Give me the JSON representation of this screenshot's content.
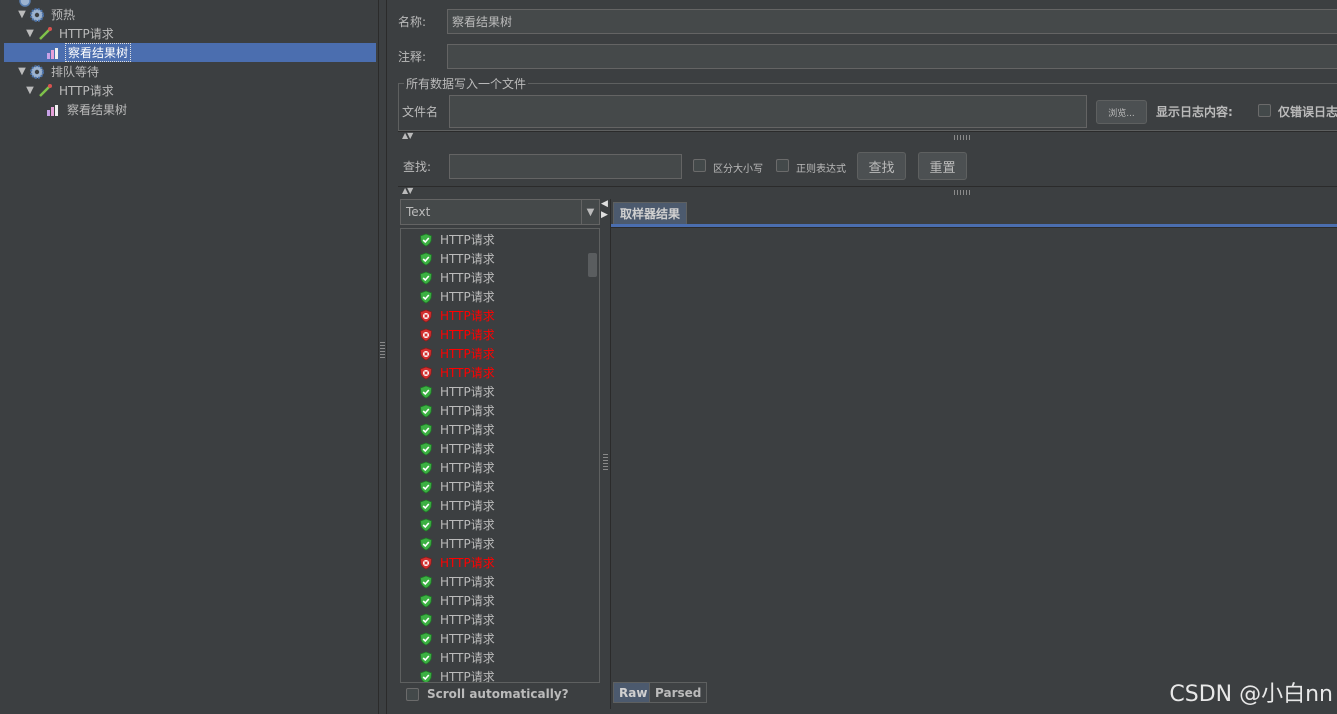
{
  "tree": {
    "items": [
      {
        "label": "预热",
        "type": "thread-group",
        "icon": "gear-icon"
      },
      {
        "label": "HTTP请求",
        "type": "sampler",
        "icon": "pipette-icon"
      },
      {
        "label": "察看结果树",
        "type": "listener",
        "icon": "chart-icon",
        "selected": true
      },
      {
        "label": "排队等待",
        "type": "thread-group",
        "icon": "gear-icon"
      },
      {
        "label": "HTTP请求",
        "type": "sampler",
        "icon": "pipette-icon"
      },
      {
        "label": "察看结果树",
        "type": "listener",
        "icon": "chart-icon"
      }
    ]
  },
  "form": {
    "name_label": "名称:",
    "name_value": "察看结果树",
    "comment_label": "注释:",
    "comment_value": "",
    "file_group_title": "所有数据写入一个文件",
    "file_label": "文件名",
    "file_value": "",
    "browse_label": "浏览...",
    "log_content_label": "显示日志内容:",
    "errors_only_label": "仅错误日志"
  },
  "search": {
    "label": "查找:",
    "value": "",
    "case_label": "区分大小写",
    "regex_label": "正则表达式",
    "find_button": "查找",
    "reset_button": "重置"
  },
  "results": {
    "renderer": "Text",
    "samples": [
      {
        "label": "HTTP请求",
        "status": "ok"
      },
      {
        "label": "HTTP请求",
        "status": "ok"
      },
      {
        "label": "HTTP请求",
        "status": "ok"
      },
      {
        "label": "HTTP请求",
        "status": "ok"
      },
      {
        "label": "HTTP请求",
        "status": "error"
      },
      {
        "label": "HTTP请求",
        "status": "error"
      },
      {
        "label": "HTTP请求",
        "status": "error"
      },
      {
        "label": "HTTP请求",
        "status": "error"
      },
      {
        "label": "HTTP请求",
        "status": "ok"
      },
      {
        "label": "HTTP请求",
        "status": "ok"
      },
      {
        "label": "HTTP请求",
        "status": "ok"
      },
      {
        "label": "HTTP请求",
        "status": "ok"
      },
      {
        "label": "HTTP请求",
        "status": "ok"
      },
      {
        "label": "HTTP请求",
        "status": "ok"
      },
      {
        "label": "HTTP请求",
        "status": "ok"
      },
      {
        "label": "HTTP请求",
        "status": "ok"
      },
      {
        "label": "HTTP请求",
        "status": "ok"
      },
      {
        "label": "HTTP请求",
        "status": "error"
      },
      {
        "label": "HTTP请求",
        "status": "ok"
      },
      {
        "label": "HTTP请求",
        "status": "ok"
      },
      {
        "label": "HTTP请求",
        "status": "ok"
      },
      {
        "label": "HTTP请求",
        "status": "ok"
      },
      {
        "label": "HTTP请求",
        "status": "ok"
      },
      {
        "label": "HTTP请求",
        "status": "ok"
      }
    ],
    "scroll_auto_label": "Scroll automatically?",
    "tab_sampler": "取样器结果",
    "tab_raw": "Raw",
    "tab_parsed": "Parsed"
  },
  "watermark": "CSDN @小白nn",
  "colors": {
    "background": "#3c3f41",
    "selection": "#4b6eaf",
    "error_text": "#ff0000",
    "ok_icon": "#3cb043",
    "error_icon": "#d32f2f"
  }
}
